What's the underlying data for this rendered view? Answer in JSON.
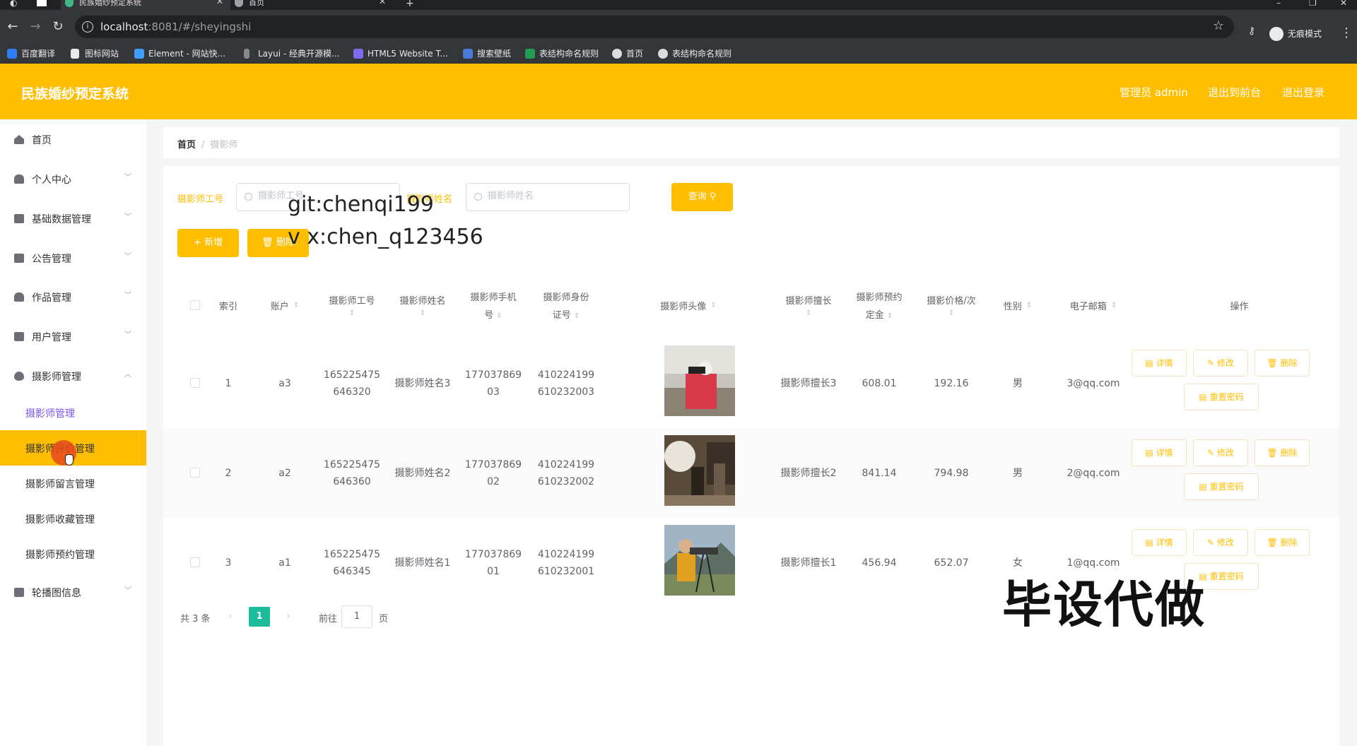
{
  "browser": {
    "tabs": [
      {
        "title": "民族婚纱预定系统",
        "active": true
      },
      {
        "title": "首页",
        "active": false
      }
    ],
    "new_tab": "+",
    "url_host": "localhost",
    "url_path": ":8081/#/sheyingshi",
    "incognito_label": "无痕模式",
    "bookmarks": [
      "百度翻译",
      "图标网站",
      "Element - 网站快...",
      "Layui - 经典开源模...",
      "HTML5 Website T...",
      "搜索壁纸",
      "表结构命名规则",
      "首页",
      "表结构命名规则"
    ]
  },
  "header": {
    "title": "民族婚纱预定系统",
    "admin": "管理员 admin",
    "frontend": "退出到前台",
    "logout": "退出登录"
  },
  "sidebar": {
    "items": [
      {
        "label": "首页",
        "icon": "home-icon"
      },
      {
        "label": "个人中心",
        "icon": "user-icon"
      },
      {
        "label": "基础数据管理",
        "icon": "data-icon"
      },
      {
        "label": "公告管理",
        "icon": "notice-icon"
      },
      {
        "label": "作品管理",
        "icon": "works-icon"
      },
      {
        "label": "用户管理",
        "icon": "users-icon"
      },
      {
        "label": "摄影师管理",
        "icon": "camera-icon"
      },
      {
        "label": "轮播图信息",
        "icon": "carousel-icon"
      }
    ],
    "sub_items": [
      "摄影师管理",
      "摄影师评价管理",
      "摄影师留言管理",
      "摄影师收藏管理",
      "摄影师预约管理"
    ]
  },
  "breadcrumb": {
    "home": "首页",
    "current": "摄影师"
  },
  "search": {
    "job_no_label": "摄影师工号",
    "job_no_placeholder": "摄影师工号",
    "name_label": "摄影师姓名",
    "name_placeholder": "摄影师姓名",
    "query_label": "查询"
  },
  "actions": {
    "add_label": "+ 新增",
    "delete_label": "删除"
  },
  "watermarks": {
    "git": "git:chenqi199",
    "vx": "v x:chen_q123456",
    "big": "毕设代做"
  },
  "table": {
    "headers": {
      "index": "索引",
      "account": "账户",
      "job_no": [
        "摄影师工号",
        ""
      ],
      "name": [
        "摄影师姓名",
        ""
      ],
      "phone": [
        "摄影师手机",
        "号"
      ],
      "id_card": [
        "摄影师身份",
        "证号"
      ],
      "avatar": "摄影师头像",
      "specialty": [
        "摄影师擅长",
        ""
      ],
      "deposit": [
        "摄影师预约",
        "定金"
      ],
      "price": [
        "摄影价格/次",
        ""
      ],
      "gender": "性别",
      "email": "电子邮箱",
      "ops": "操作"
    },
    "rows": [
      {
        "index": "1",
        "account": "a3",
        "job_no": [
          "165225475",
          "646320"
        ],
        "name": "摄影师姓名3",
        "phone": [
          "177037869",
          "03"
        ],
        "id_card": [
          "410224199",
          "610232003"
        ],
        "specialty": "摄影师擅长3",
        "deposit": "608.01",
        "price": "192.16",
        "gender": "男",
        "email": "3@qq.com"
      },
      {
        "index": "2",
        "account": "a2",
        "job_no": [
          "165225475",
          "646360"
        ],
        "name": "摄影师姓名2",
        "phone": [
          "177037869",
          "02"
        ],
        "id_card": [
          "410224199",
          "610232002"
        ],
        "specialty": "摄影师擅长2",
        "deposit": "841.14",
        "price": "794.98",
        "gender": "男",
        "email": "2@qq.com"
      },
      {
        "index": "3",
        "account": "a1",
        "job_no": [
          "165225475",
          "646345"
        ],
        "name": "摄影师姓名1",
        "phone": [
          "177037869",
          "01"
        ],
        "id_card": [
          "410224199",
          "610232001"
        ],
        "specialty": "摄影师擅长1",
        "deposit": "456.94",
        "price": "652.07",
        "gender": "女",
        "email": "1@qq.com"
      }
    ],
    "op_labels": {
      "detail": "详情",
      "edit": "修改",
      "delete": "删除",
      "reset": "重置密码"
    }
  },
  "pagination": {
    "total": "共 3 条",
    "prev": "‹",
    "current": "1",
    "next": "›",
    "goto_prefix": "前往",
    "goto_value": "1",
    "goto_suffix": "页"
  },
  "colors": {
    "accent": "#ffbe00",
    "active_page": "#1abc9c",
    "submenu_active": "#7b55e8"
  }
}
